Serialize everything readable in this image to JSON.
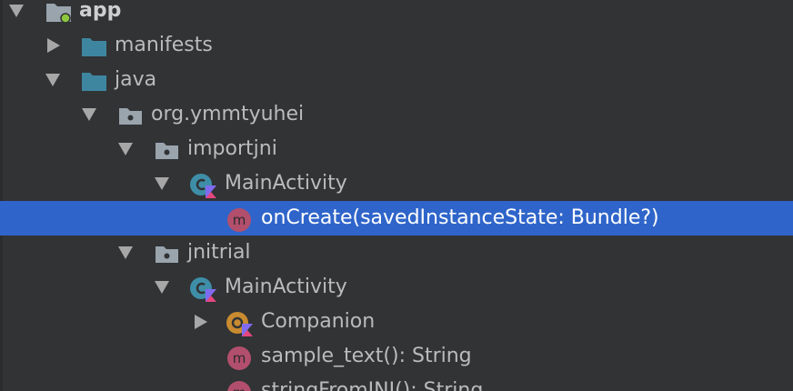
{
  "tree": {
    "app": "app",
    "manifests": "manifests",
    "java": "java",
    "org_ymmtyuhei": "org.ymmtyuhei",
    "importjni": "importjni",
    "importjni_main_activity": "MainActivity",
    "on_create": "onCreate(savedInstanceState: Bundle?)",
    "jnitrial": "jnitrial",
    "jnitrial_main_activity": "MainActivity",
    "companion": "Companion",
    "sample_text": "sample_text(): String",
    "string_from_jni": "stringFromJNI(): String"
  },
  "icons": {
    "folder": "folder-icon",
    "package": "package-icon",
    "kotlin_class": "kotlin-class-icon",
    "kotlin_object": "kotlin-object-icon",
    "method": "method-icon"
  },
  "colors": {
    "background": "#313335",
    "selection": "#2f65ca",
    "folder_blue": "#3e86a0",
    "package_gray": "#9aa4ad",
    "class_teal": "#3f8ea8",
    "object_orange": "#c98b30",
    "method_pink": "#b24f6c"
  }
}
